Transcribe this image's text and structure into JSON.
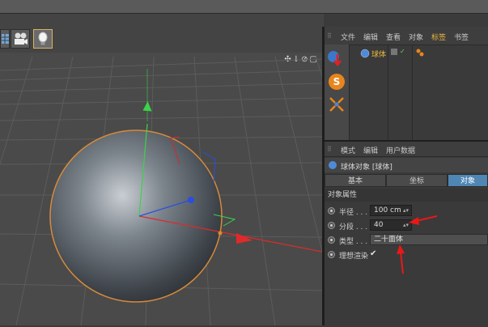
{
  "object_manager": {
    "menu": [
      "文件",
      "编辑",
      "查看",
      "对象",
      "标签",
      "书签"
    ],
    "active_menu": "标签",
    "object_name": "球体"
  },
  "attribute_manager": {
    "menu": [
      "模式",
      "编辑",
      "用户数据"
    ],
    "title": "球体对象 [球体]",
    "tabs": [
      "基本",
      "坐标",
      "对象"
    ],
    "active_tab": "对象",
    "section": "对象属性",
    "params": {
      "radius": {
        "label": "半径 . . .",
        "value": "100 cm"
      },
      "segments": {
        "label": "分段 . . .",
        "value": "40"
      },
      "type": {
        "label": "类型 . . .",
        "value": "二十面体"
      },
      "render_perfect": {
        "label": "理想渲染",
        "value": "✔"
      }
    }
  },
  "viewport": {
    "controls": "✣↓⊘▢"
  },
  "colors": {
    "accent": "#e7b73f",
    "tab_active": "#4f86b4",
    "annotation": "#e81818"
  }
}
